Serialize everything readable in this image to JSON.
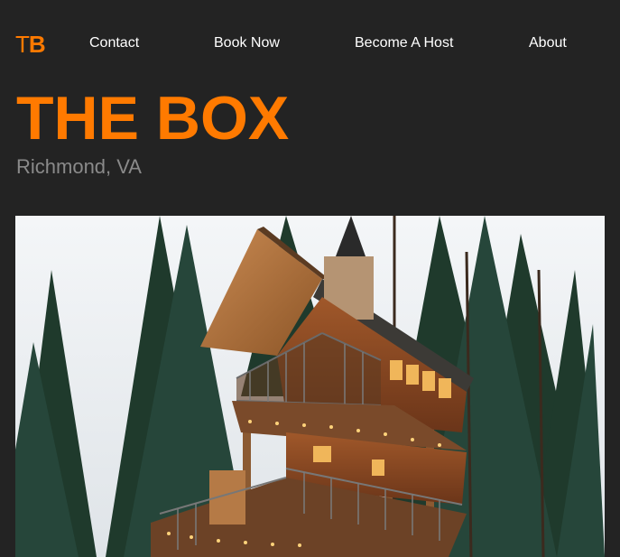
{
  "header": {
    "logo_prefix": "T",
    "logo_suffix": "B",
    "nav": [
      {
        "label": "Contact"
      },
      {
        "label": "Book Now"
      },
      {
        "label": "Become A Host"
      },
      {
        "label": "About"
      }
    ]
  },
  "hero": {
    "title": "THE BOX",
    "location": "Richmond, VA"
  },
  "colors": {
    "background": "#232323",
    "accent": "#ff7a00",
    "nav_text": "#ffffff",
    "subtitle": "#8a8a8a"
  },
  "photo": {
    "subject": "treehouse-in-pine-forest"
  }
}
